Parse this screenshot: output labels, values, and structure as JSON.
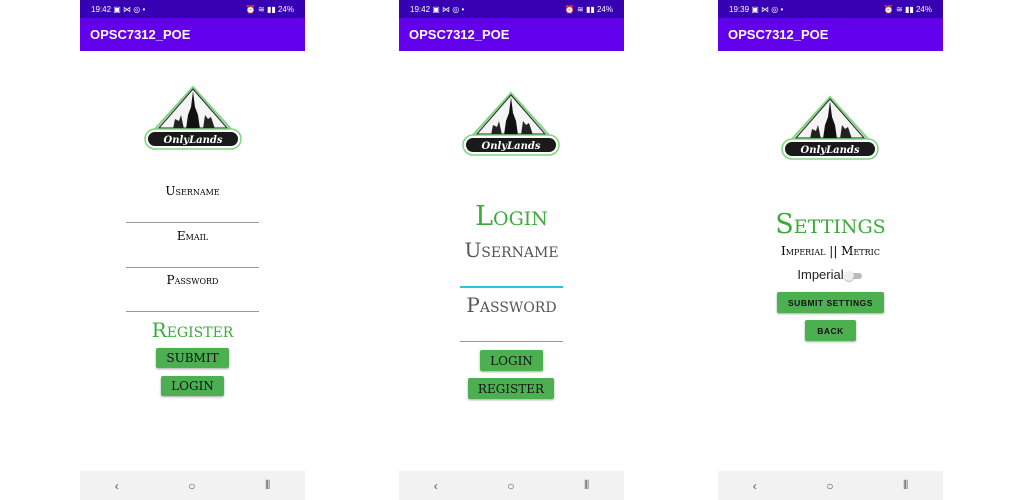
{
  "app_title": "OPSC7312_POE",
  "logo_text": "OnlyLands",
  "colors": {
    "status_bar": "#3700b3",
    "app_bar": "#6200ee",
    "accent_green": "#3cab3c",
    "button_green": "#4caf50",
    "focus_line": "#26c6da"
  },
  "screens": [
    {
      "status": {
        "time": "19:42",
        "left_icons": "▣ ⋈ ◎ •",
        "battery": "24%"
      },
      "fields": [
        {
          "label": "Username"
        },
        {
          "label": "Email"
        },
        {
          "label": "Password"
        }
      ],
      "title": "Register",
      "buttons": [
        "SUBMIT",
        "LOGIN"
      ]
    },
    {
      "status": {
        "time": "19:42",
        "left_icons": "▣ ⋈ ◎ •",
        "battery": "24%"
      },
      "title": "Login",
      "fields": [
        {
          "label": "Username"
        },
        {
          "label": "Password"
        }
      ],
      "buttons": [
        "LOGIN",
        "REGISTER"
      ]
    },
    {
      "status": {
        "time": "19:39",
        "left_icons": "▣ ⋈ ◎ •",
        "battery": "24%"
      },
      "title": "Settings",
      "subtitle": "Imperial || Metric",
      "switch_label": "Imperial",
      "switch_on": false,
      "buttons": [
        "SUBMIT SETTINGS",
        "BACK"
      ]
    }
  ],
  "nav": {
    "back": "‹",
    "home": "○",
    "recents": "⦀"
  }
}
